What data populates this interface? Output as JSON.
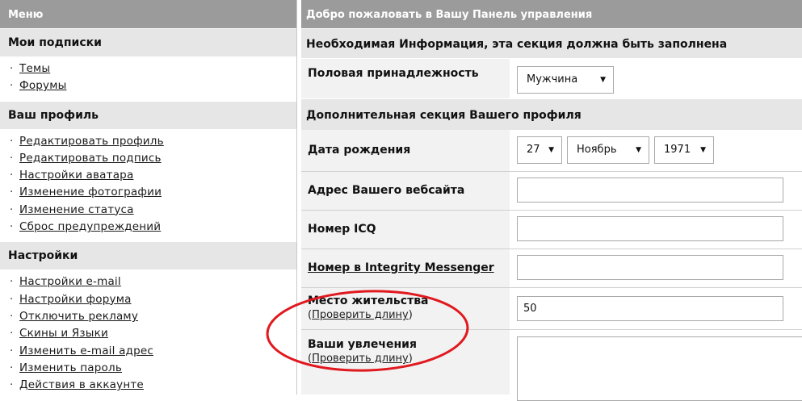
{
  "sidebar": {
    "title": "Меню",
    "sections": [
      {
        "title": "Мои подписки",
        "items": [
          "Темы",
          "Форумы"
        ]
      },
      {
        "title": "Ваш профиль",
        "items": [
          "Редактировать профиль",
          "Редактировать подпись",
          "Настройки аватара",
          "Изменение фотографии",
          "Изменение статуса",
          "Сброс предупреждений"
        ]
      },
      {
        "title": "Настройки",
        "items": [
          "Настройки e-mail",
          "Настройки форума",
          "Отключить рекламу",
          "Скины и Языки",
          "Изменить e-mail адрес",
          "Изменить пароль",
          "Действия в аккаунте"
        ]
      }
    ],
    "bullet": "·"
  },
  "main": {
    "title": "Добро пожаловать в Вашу Панель управления",
    "required_header": "Необходимая Информация, эта секция должна быть заполнена",
    "gender": {
      "label": "Половая принадлежность",
      "value": "Мужчина"
    },
    "optional_header": "Дополнительная секция Вашего профиля",
    "birthdate": {
      "label": "Дата рождения",
      "day": "27",
      "month": "Ноябрь",
      "year": "1971"
    },
    "website": {
      "label": "Адрес Вашего вебсайта",
      "value": ""
    },
    "icq": {
      "label": "Номер ICQ",
      "value": ""
    },
    "integrity": {
      "label": "Номер в Integrity Messenger",
      "value": ""
    },
    "location": {
      "label": "Место жительства",
      "check_link": "Проверить длину",
      "value": "50"
    },
    "interests": {
      "label": "Ваши увлечения",
      "check_link": "Проверить длину",
      "value": ""
    },
    "paren_open": "(",
    "paren_close": ")"
  },
  "colors": {
    "highlight_ellipse": "#e0191f",
    "title_bar": "#9b9b9b",
    "section_bg": "#e6e6e6"
  },
  "icons": {
    "dropdown": "chevron-down-icon"
  }
}
